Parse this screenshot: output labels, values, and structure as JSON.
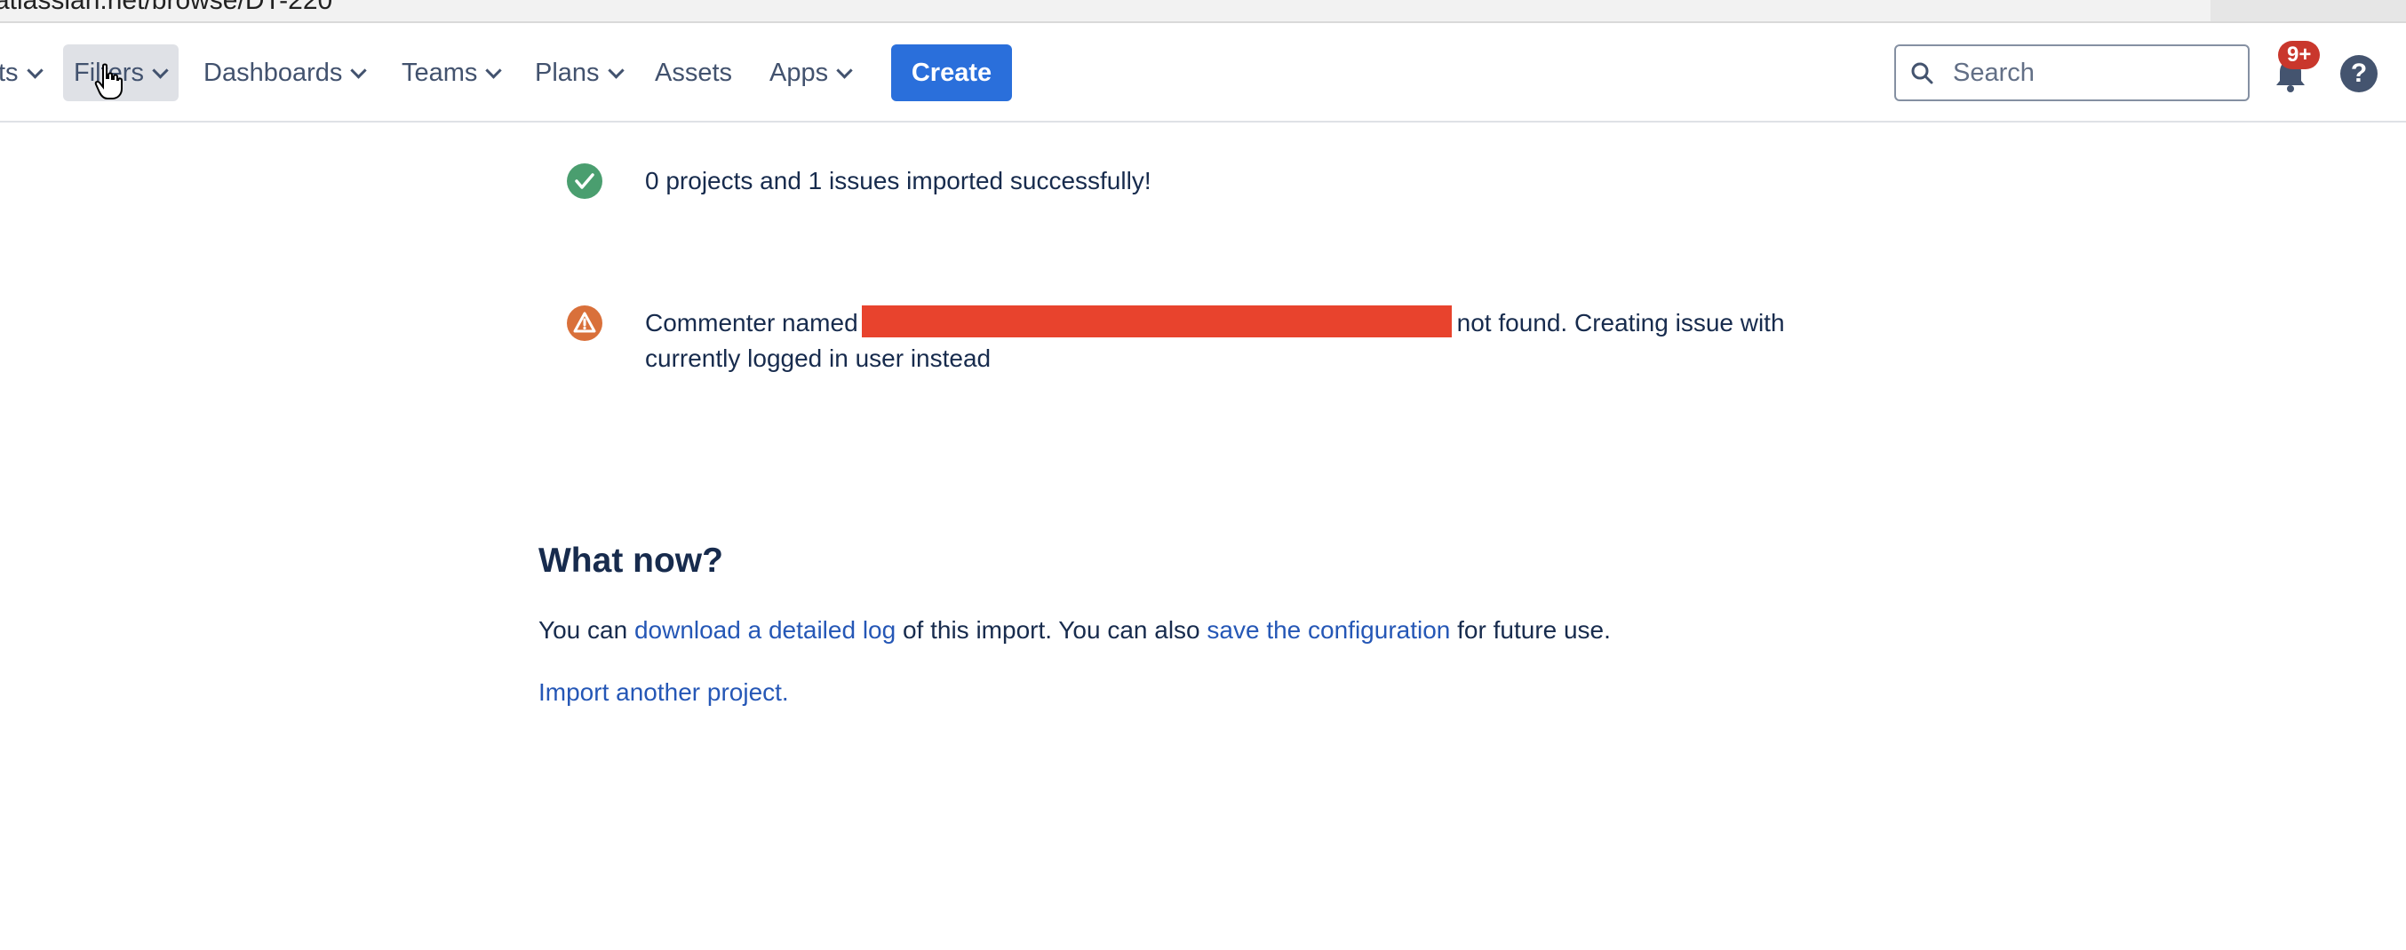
{
  "browser": {
    "url_fragment": "atlassian.net/browse/DT-220"
  },
  "nav": {
    "items": [
      {
        "label": "ts",
        "has_dropdown": true
      },
      {
        "label": "Filters",
        "has_dropdown": true
      },
      {
        "label": "Dashboards",
        "has_dropdown": true
      },
      {
        "label": "Teams",
        "has_dropdown": true
      },
      {
        "label": "Plans",
        "has_dropdown": true
      },
      {
        "label": "Assets",
        "has_dropdown": false
      },
      {
        "label": "Apps",
        "has_dropdown": true
      }
    ],
    "create_label": "Create",
    "search_placeholder": "Search",
    "notification_badge": "9+",
    "help_label": "?"
  },
  "messages": {
    "success_text": "0 projects and 1 issues imported successfully!",
    "warning_prefix": "Commenter named",
    "warning_suffix": "not found. Creating issue with",
    "warning_line2": "currently logged in user instead"
  },
  "what_now": {
    "heading": "What now?",
    "p1_a": "You can ",
    "p1_link1": "download a detailed log",
    "p1_b": " of this import. You can also ",
    "p1_link2": "save the configuration",
    "p1_c": " for future use.",
    "import_link": "Import another project."
  },
  "colors": {
    "success": "#4a9e6f",
    "warning": "#d9703a",
    "primary": "#2a6fdb",
    "redaction": "#e8432d",
    "badge": "#c9372c"
  }
}
